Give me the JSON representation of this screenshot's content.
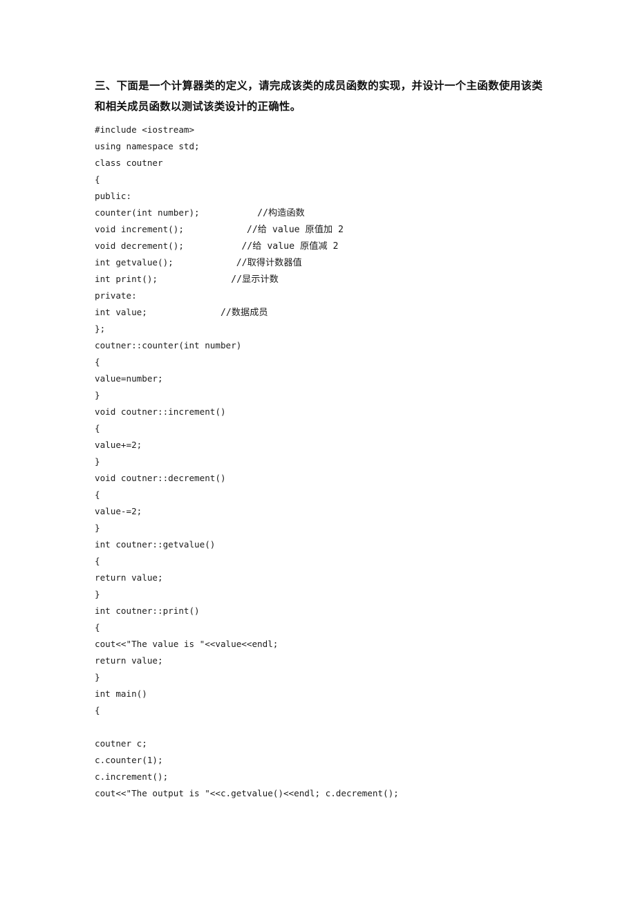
{
  "document": {
    "heading": "三、下面是一个计算器类的定义，请完成该类的成员函数的实现，并设计一个主函数使用该类和相关成员函数以测试该类设计的正确性。",
    "code_lines": [
      {
        "code": "#include <iostream>",
        "comment": ""
      },
      {
        "code": "using namespace std;",
        "comment": ""
      },
      {
        "code": "class coutner",
        "comment": ""
      },
      {
        "code": "{",
        "comment": ""
      },
      {
        "code": "public:",
        "comment": ""
      },
      {
        "code": "counter(int number);",
        "comment": "//构造函数",
        "comment_col": 31
      },
      {
        "code": "void increment();",
        "comment": "//给 value 原值加 2",
        "comment_col": 29
      },
      {
        "code": "void decrement();",
        "comment": "//给 value 原值减 2",
        "comment_col": 28
      },
      {
        "code": "int getvalue();",
        "comment": "//取得计数器值",
        "comment_col": 27
      },
      {
        "code": "int print();",
        "comment": "//显示计数",
        "comment_col": 26
      },
      {
        "code": "private:",
        "comment": ""
      },
      {
        "code": "int value;",
        "comment": "//数据成员",
        "comment_col": 24
      },
      {
        "code": "};",
        "comment": ""
      },
      {
        "code": "coutner::counter(int number)",
        "comment": ""
      },
      {
        "code": "{",
        "comment": ""
      },
      {
        "code": "value=number;",
        "comment": ""
      },
      {
        "code": "}",
        "comment": ""
      },
      {
        "code": "void coutner::increment()",
        "comment": ""
      },
      {
        "code": "{",
        "comment": ""
      },
      {
        "code": "value+=2;",
        "comment": ""
      },
      {
        "code": "}",
        "comment": ""
      },
      {
        "code": "void coutner::decrement()",
        "comment": ""
      },
      {
        "code": "{",
        "comment": ""
      },
      {
        "code": "value-=2;",
        "comment": ""
      },
      {
        "code": "}",
        "comment": ""
      },
      {
        "code": "int coutner::getvalue()",
        "comment": ""
      },
      {
        "code": "{",
        "comment": ""
      },
      {
        "code": "return value;",
        "comment": ""
      },
      {
        "code": "}",
        "comment": ""
      },
      {
        "code": "int coutner::print()",
        "comment": ""
      },
      {
        "code": "{",
        "comment": ""
      },
      {
        "code": "cout<<\"The value is \"<<value<<endl;",
        "comment": ""
      },
      {
        "code": "return value;",
        "comment": ""
      },
      {
        "code": "}",
        "comment": ""
      },
      {
        "code": "int main()",
        "comment": ""
      },
      {
        "code": "{",
        "comment": ""
      },
      {
        "code": "",
        "comment": ""
      },
      {
        "code": "coutner c;",
        "comment": ""
      },
      {
        "code": "c.counter(1);",
        "comment": ""
      },
      {
        "code": "c.increment();",
        "comment": ""
      },
      {
        "code": "cout<<\"The output is \"<<c.getvalue()<<endl; c.decrement();",
        "comment": ""
      }
    ]
  }
}
